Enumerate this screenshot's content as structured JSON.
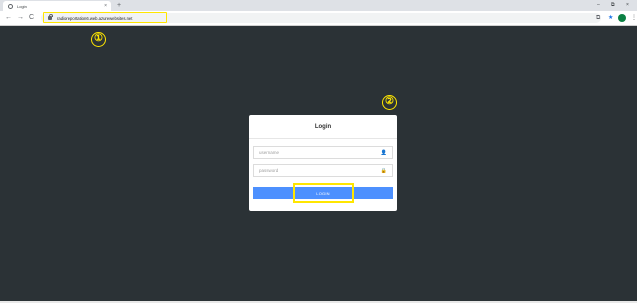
{
  "browser": {
    "tab_title": "Login",
    "tab_close": "×",
    "new_tab": "+",
    "url": "radioreportation6.web.azurewebsites.net",
    "nav": {
      "back": "←",
      "forward": "→",
      "reload": "C"
    },
    "window_controls": {
      "minimize": "–",
      "maximize": "⧉",
      "close": "×"
    },
    "toolbar_icons": {
      "extension": "⧉",
      "star": "★",
      "menu": "⋮"
    }
  },
  "annotations": {
    "callout_1": "①",
    "callout_2": "②"
  },
  "login": {
    "title": "Login",
    "username_placeholder": "username",
    "password_placeholder": "password",
    "username_icon": "👤",
    "password_icon": "🔒",
    "button_label": "LOGIN"
  },
  "colors": {
    "page_background": "#2b3236",
    "primary_button": "#4d90fe",
    "highlight": "#ffe600"
  }
}
